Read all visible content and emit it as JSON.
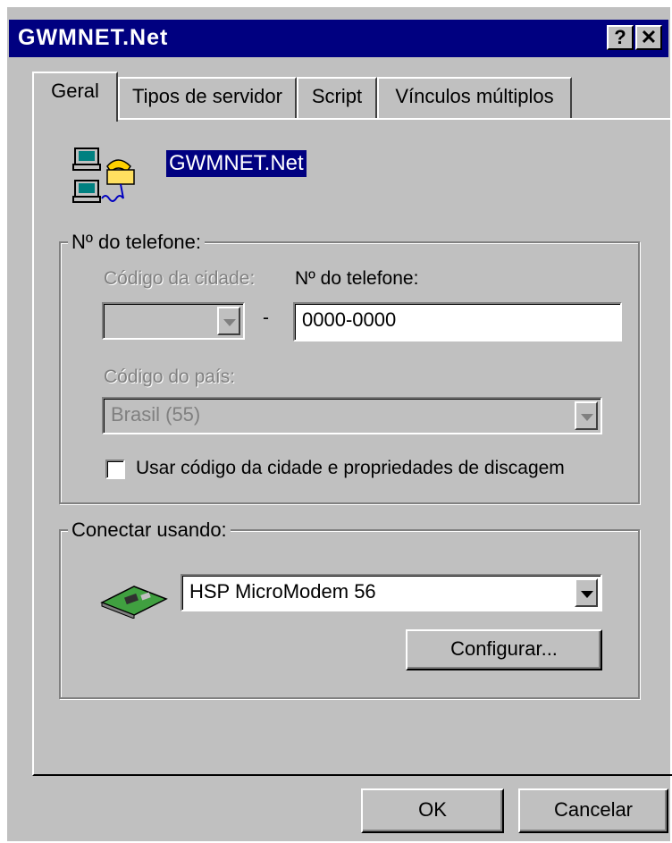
{
  "window": {
    "title": "GWMNET.Net",
    "help_button": "?",
    "close_button": "✕"
  },
  "tabs": [
    {
      "label": "Geral",
      "active": true
    },
    {
      "label": "Tipos de servidor"
    },
    {
      "label": "Script"
    },
    {
      "label": "Vínculos múltiplos"
    }
  ],
  "connection": {
    "name": "GWMNET.Net"
  },
  "phone_group": {
    "legend": "Nº do telefone:",
    "area_code_label": "Código da cidade:",
    "dash": "-",
    "phone_label": "Nº do telefone:",
    "phone_value": "0000-0000",
    "country_label": "Código do país:",
    "country_value": "Brasil (55)",
    "checkbox_label": "Usar código da cidade e propriedades de discagem",
    "checkbox_checked": false
  },
  "connect_group": {
    "legend": "Conectar usando:",
    "modem_value": "HSP MicroModem 56",
    "configure_button": "Configurar..."
  },
  "footer": {
    "ok_button": "OK",
    "cancel_button": "Cancelar"
  },
  "colors": {
    "titlebar": "#000080",
    "face": "#c0c0c0",
    "selection": "#000080"
  },
  "icons": {
    "connection": "dialup-computers-icon",
    "modem": "modem-card-icon"
  }
}
